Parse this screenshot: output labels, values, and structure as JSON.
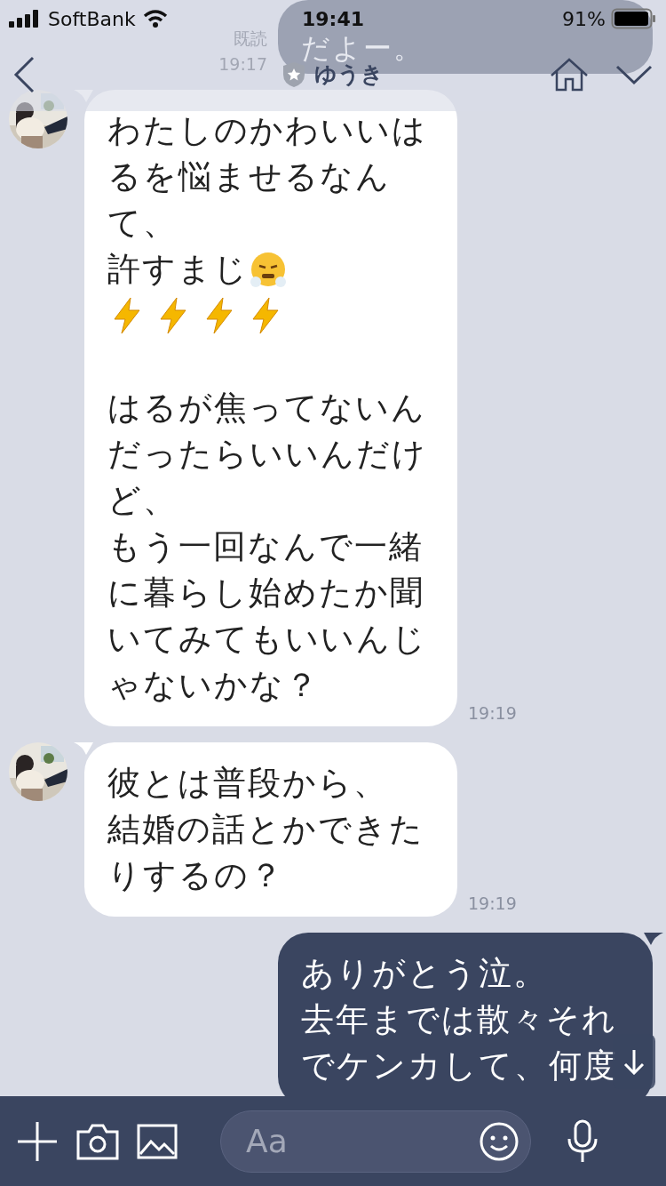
{
  "status_bar": {
    "carrier": "SoftBank",
    "time": "19:41",
    "battery": "91%"
  },
  "header": {
    "title": "ゆうき"
  },
  "messages": [
    {
      "kind": "sent",
      "lines": [
        {
          "text": "だよー。"
        }
      ],
      "read": "既読",
      "time": "19:17"
    },
    {
      "kind": "received",
      "lines": [
        {
          "text": "わたしのかわいいは"
        },
        {
          "text": "るを悩ませるなん"
        },
        {
          "text": "て、"
        },
        {
          "text": "許すまじ",
          "emoji": [
            {
              "kind": "huff"
            }
          ]
        },
        {
          "emoji": [
            {
              "kind": "bolt"
            },
            {
              "kind": "bolt"
            },
            {
              "kind": "bolt"
            },
            {
              "kind": "bolt"
            }
          ]
        },
        {
          "text": "はるが焦ってないん",
          "space_before": true
        },
        {
          "text": "だったらいいんだけ"
        },
        {
          "text": "ど、"
        },
        {
          "text": "もう一回なんで一緒"
        },
        {
          "text": "に暮らし始めたか聞"
        },
        {
          "text": "いてみてもいいんじ"
        },
        {
          "text": "ゃないかな？"
        }
      ],
      "time": "19:19"
    },
    {
      "kind": "received",
      "lines": [
        {
          "text": "彼とは普段から、"
        },
        {
          "text": "結婚の話とかできた"
        },
        {
          "text": "りするの？"
        }
      ],
      "time": "19:19"
    },
    {
      "kind": "sent",
      "lines": [
        {
          "text": "ありがとう泣。"
        },
        {
          "text": "去年までは散々それ"
        },
        {
          "text": "でケンカして、何度"
        }
      ]
    }
  ],
  "input": {
    "placeholder": "Aa"
  }
}
